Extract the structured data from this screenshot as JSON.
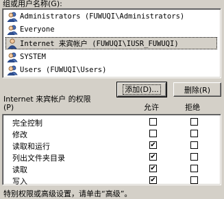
{
  "group_label": "组或用户名称(G):",
  "users": [
    {
      "name": "Administrators (FUWUQI\\Administrators)",
      "icon": "user-group-icon",
      "selected": false
    },
    {
      "name": "Everyone",
      "icon": "user-group-icon",
      "selected": false
    },
    {
      "name": "Internet 来宾帐户 (FUWUQI\\IUSR_FUWUQI)",
      "icon": "user-icon",
      "selected": true
    },
    {
      "name": "SYSTEM",
      "icon": "user-group-icon",
      "selected": false
    },
    {
      "name": "Users (FUWUQI\\Users)",
      "icon": "user-group-icon",
      "selected": false
    }
  ],
  "buttons": {
    "add": "添加(D)...",
    "remove": "删除(R)"
  },
  "permissions": {
    "title": "Internet 来宾帐户 的权限",
    "title_hotkey": "(P)",
    "allow_header": "允许",
    "deny_header": "拒绝",
    "rows": [
      {
        "label": "完全控制",
        "allow": false,
        "deny": false
      },
      {
        "label": "修改",
        "allow": false,
        "deny": false
      },
      {
        "label": "读取和运行",
        "allow": true,
        "deny": false
      },
      {
        "label": "列出文件夹目录",
        "allow": true,
        "deny": false
      },
      {
        "label": "读取",
        "allow": true,
        "deny": false
      },
      {
        "label": "写入",
        "allow": true,
        "deny": false
      }
    ]
  },
  "bottom_text": "特别权限或高级设置，请单击“高级”。"
}
